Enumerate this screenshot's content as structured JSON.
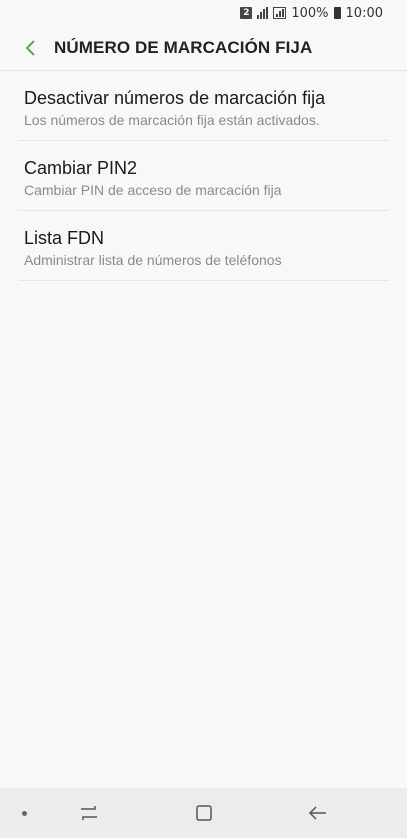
{
  "status_bar": {
    "sim": "2",
    "battery_text": "100%",
    "time": "10:00"
  },
  "header": {
    "title": "NÚMERO DE MARCACIÓN FIJA",
    "accent_color": "#4caf50"
  },
  "items": [
    {
      "title": "Desactivar números de marcación fija",
      "subtitle": "Los números de marcación fija están activados."
    },
    {
      "title": "Cambiar PIN2",
      "subtitle": "Cambiar PIN de acceso de marcación fija"
    },
    {
      "title": "Lista FDN",
      "subtitle": "Administrar lista de números de teléfonos"
    }
  ],
  "nav_bar": {
    "icons": [
      "dot-icon",
      "recent-apps-icon",
      "home-icon",
      "back-icon"
    ]
  }
}
